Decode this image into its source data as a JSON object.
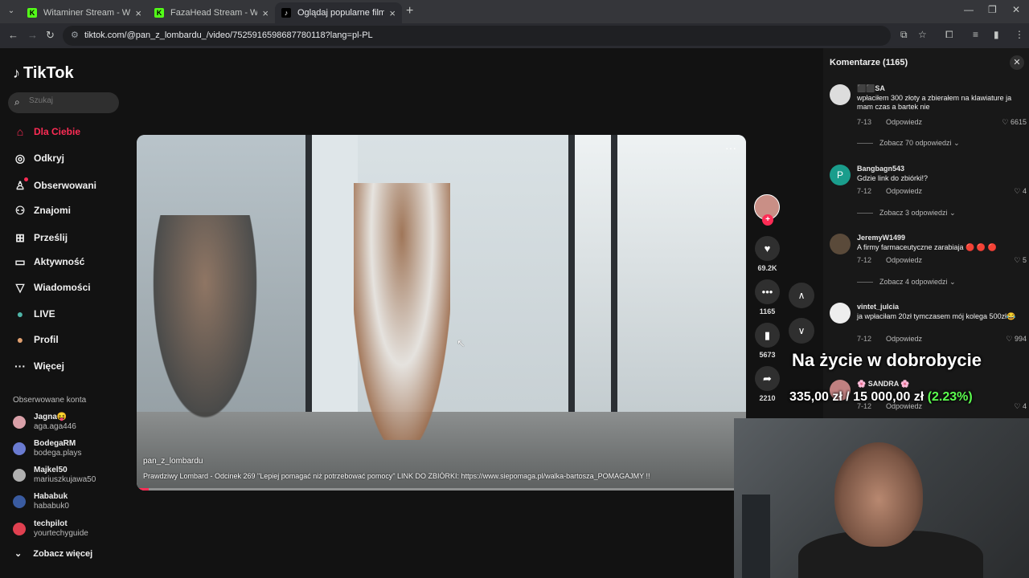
{
  "browser": {
    "tabs": [
      {
        "title": "Witaminer Stream - Watch Live",
        "icon": "kick-favicon",
        "active": false
      },
      {
        "title": "FazaHead Stream - Watch Live",
        "icon": "kick-favicon",
        "active": false
      },
      {
        "title": "Oglądaj popularne filmy | TikTok",
        "icon": "tiktok-favicon",
        "active": true
      }
    ],
    "url": "tiktok.com/@pan_z_lombardu_/video/7525916598687780118?lang=pl-PL"
  },
  "tiktok": {
    "logo": "TikTok",
    "search_placeholder": "Szukaj",
    "menu": [
      {
        "label": "Dla Ciebie",
        "icon": "home-icon",
        "active": true
      },
      {
        "label": "Odkryj",
        "icon": "compass-icon"
      },
      {
        "label": "Obserwowani",
        "icon": "following-icon"
      },
      {
        "label": "Znajomi",
        "icon": "friends-icon"
      },
      {
        "label": "Prześlij",
        "icon": "upload-icon"
      },
      {
        "label": "Aktywność",
        "icon": "activity-icon"
      },
      {
        "label": "Wiadomości",
        "icon": "messages-icon"
      },
      {
        "label": "LIVE",
        "icon": "live-icon"
      },
      {
        "label": "Profil",
        "icon": "profile-icon"
      },
      {
        "label": "Więcej",
        "icon": "more-icon"
      }
    ],
    "followed_title": "Obserwowane konta",
    "followed": [
      {
        "name": "Jagna😝",
        "handle": "aga.aga446",
        "color": "#d9a0a8"
      },
      {
        "name": "BodegaRM",
        "handle": "bodega.plays",
        "color": "#6a7bd1"
      },
      {
        "name": "Majkel50",
        "handle": "mariuszkujawa50",
        "color": "#b0b0b0"
      },
      {
        "name": "Hababuk",
        "handle": "hababuk0",
        "color": "#3a5ba0"
      },
      {
        "name": "techpilot",
        "handle": "yourtechyguide",
        "color": "#e04050"
      }
    ],
    "see_more": "Zobacz więcej"
  },
  "video": {
    "author": "pan_z_lombardu",
    "description": "Prawdziwy Lombard - Odcinek 269 \"Lepiej pomagać niż potrzebować pomocy\" LINK DO ZBIÓRKI: https://www.siepomaga.pl/walka-bartosza_POMAGAJMY !!",
    "progress": 0.02,
    "menu_glyph": "···"
  },
  "actions": {
    "likes": "69.2K",
    "comments": "1165",
    "saves": "5673",
    "shares": "2210"
  },
  "comments": {
    "header": "Komentarze (1165)",
    "items": [
      {
        "user": "⬛⬛SA",
        "text": "wpłaciłem 300 złoty a zbierałem na klawiature ja mam czas a bartek nie",
        "date": "7-13",
        "reply": "Odpowiedz",
        "likes": "6615",
        "color": "#ddd"
      },
      {
        "user": "Bangbagn543",
        "text": "Gdzie link do zbiórki!?",
        "date": "7-12",
        "reply": "Odpowiedz",
        "likes": "4",
        "color": "#1a9d8c",
        "initial": "P"
      },
      {
        "user": "JeremyW1499",
        "text": "A firmy farmaceutyczne zarabiaja 🔴 🔴 🔴",
        "date": "7-12",
        "reply": "Odpowiedz",
        "likes": "5",
        "color": "#5a4a3a"
      },
      {
        "user": "vintet_julcia",
        "text": "ja wpłaciłam 20zł tymczasem mój kolega 500zł😂",
        "date": "7-12",
        "reply": "Odpowiedz",
        "likes": "994",
        "color": "#eee"
      },
      {
        "user": "🌸 SANDRA 🌸",
        "text": "",
        "date": "7-12",
        "reply": "Odpowiedz",
        "likes": "4",
        "color": "#c08080"
      }
    ],
    "replies": [
      "Zobacz 70 odpowiedzi",
      "Zobacz 3 odpowiedzi",
      "Zobacz 4 odpowiedzi"
    ]
  },
  "overlay": {
    "title": "Na życie w dobrobycie",
    "amount": "335,00 zł / 15 000,00 zł",
    "percent": "(2.23%)"
  }
}
